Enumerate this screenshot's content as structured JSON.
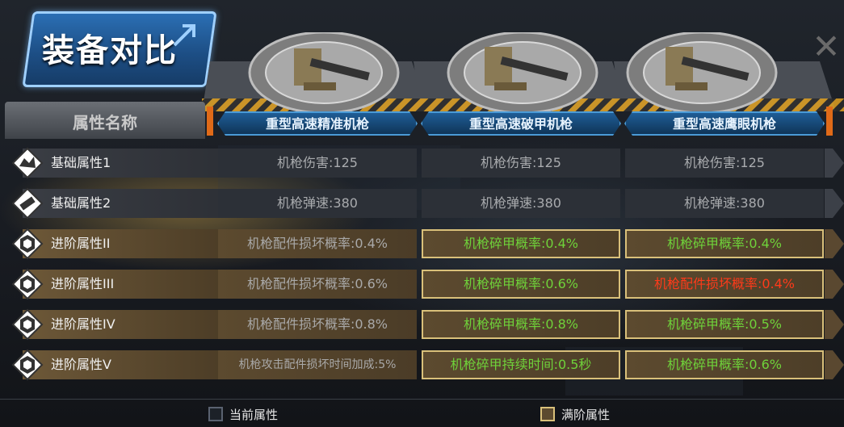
{
  "header": {
    "title": "装备对比",
    "property_header": "属性名称",
    "close_symbol": "✕"
  },
  "columns": [
    {
      "name": "重型高速精准机枪",
      "icon": "heavy-machine-gun-icon"
    },
    {
      "name": "重型高速破甲机枪",
      "icon": "heavy-machine-gun-icon"
    },
    {
      "name": "重型高速鹰眼机枪",
      "icon": "heavy-machine-gun-icon"
    }
  ],
  "rows": [
    {
      "label": "基础属性1",
      "kind": "basic",
      "icon": "broken-tank-icon",
      "values": [
        "机枪伤害:125",
        "机枪伤害:125",
        "机枪伤害:125"
      ]
    },
    {
      "label": "基础属性2",
      "kind": "basic",
      "icon": "bullet-icon",
      "values": [
        "机枪弹速:380",
        "机枪弹速:380",
        "机枪弹速:380"
      ]
    },
    {
      "label": "进阶属性II",
      "kind": "advanced",
      "icon": "hexagon-gear-icon",
      "values": [
        "机枪配件损坏概率:0.4%",
        "机枪碎甲概率:0.4%",
        "机枪碎甲概率:0.4%"
      ]
    },
    {
      "label": "进阶属性III",
      "kind": "advanced",
      "icon": "hexagon-gear-icon",
      "values": [
        "机枪配件损坏概率:0.6%",
        "机枪碎甲概率:0.6%",
        "机枪配件损坏概率:0.4%"
      ]
    },
    {
      "label": "进阶属性IV",
      "kind": "advanced",
      "icon": "hexagon-gear-icon",
      "values": [
        "机枪配件损坏概率:0.8%",
        "机枪碎甲概率:0.8%",
        "机枪碎甲概率:0.5%"
      ]
    },
    {
      "label": "进阶属性V",
      "kind": "advanced",
      "icon": "hexagon-gear-icon",
      "values": [
        "机枪攻击配件损坏时间加成:5%",
        "机枪碎甲持续时间:0.5秒",
        "机枪碎甲概率:0.6%"
      ]
    }
  ],
  "legend": {
    "current": "当前属性",
    "max": "满阶属性"
  },
  "colors": {
    "accent_blue": "#2b6fb4",
    "advanced_green": "#6fd23a",
    "warning_red": "#ff3a1a",
    "max_border": "#d9c07a",
    "orange": "#e06a18"
  }
}
